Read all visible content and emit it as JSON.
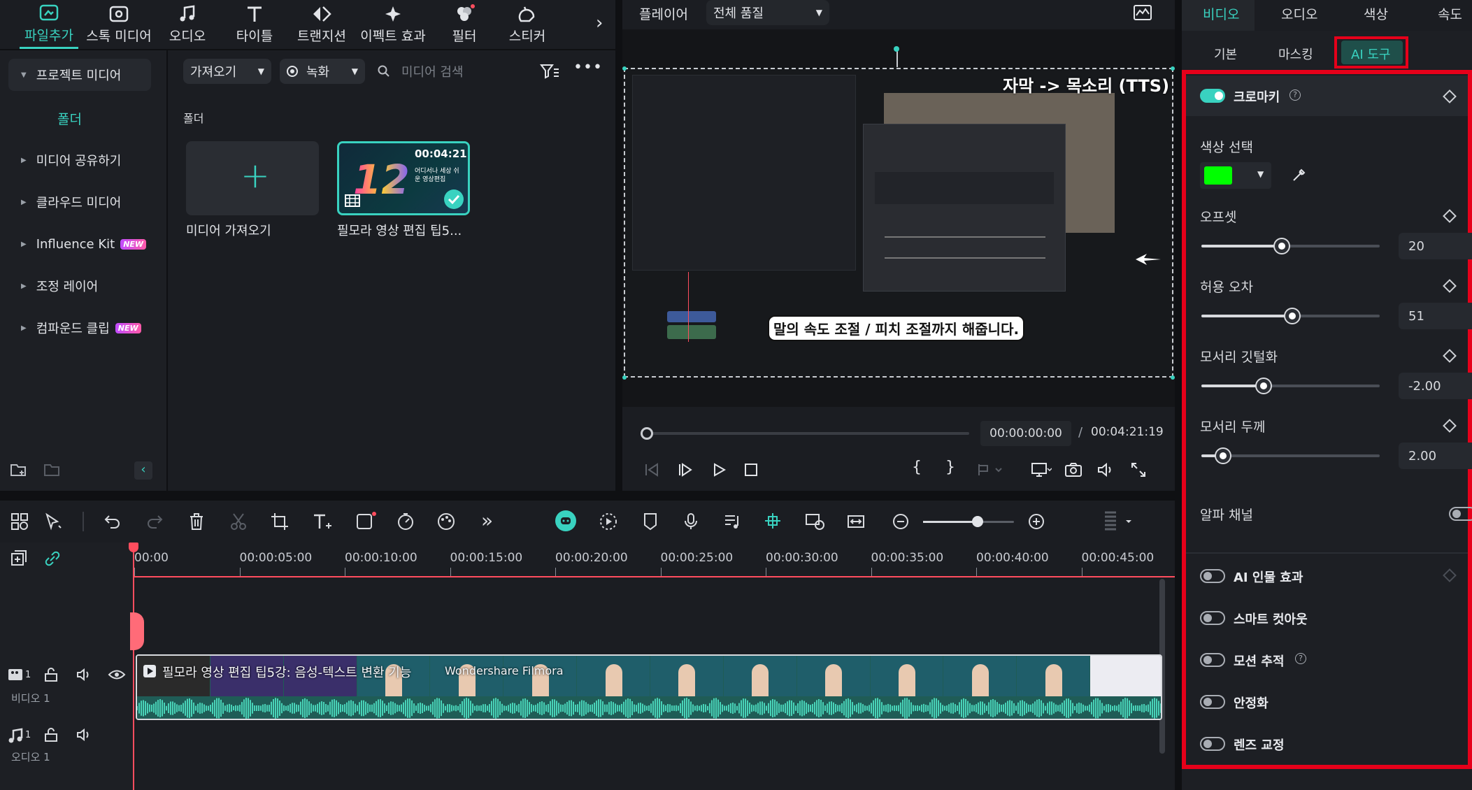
{
  "toolbar": {
    "items": [
      {
        "label": "파일추가",
        "icon": "import-icon",
        "active": true
      },
      {
        "label": "스톡 미디어",
        "icon": "stock-media-icon"
      },
      {
        "label": "오디오",
        "icon": "music-note-icon"
      },
      {
        "label": "타이틀",
        "icon": "title-t-icon"
      },
      {
        "label": "트랜지션",
        "icon": "transition-icon"
      },
      {
        "label": "이펙트 효과",
        "icon": "effects-sparkle-icon"
      },
      {
        "label": "필터",
        "icon": "filter-circles-icon"
      },
      {
        "label": "스티커",
        "icon": "sticker-icon"
      }
    ],
    "accent": "#39d2c0"
  },
  "media_sidebar": {
    "project_media": "프로젝트 미디어",
    "folder": "폴더",
    "items": [
      {
        "label": "미디어 공유하기"
      },
      {
        "label": "클라우드 미디어"
      },
      {
        "label": "Influence Kit",
        "badge": "NEW"
      },
      {
        "label": "조정 레이어"
      },
      {
        "label": "컴파운드 클립",
        "badge": "NEW"
      }
    ]
  },
  "media_main": {
    "import_dropdown": "가져오기",
    "record_dropdown": "녹화",
    "search_placeholder": "미디어 검색",
    "folder_title": "폴더",
    "import_tile_label": "미디어 가져오기",
    "clip_tile": {
      "duration": "00:04:21",
      "label": "필모라 영상 편집 팁5...",
      "thumb_caption": "어디서나 세상 쉬운 영상편집"
    }
  },
  "player": {
    "title": "플레이어",
    "quality": "전체 품질",
    "overlay_top": "자막 -> 목소리 (TTS)",
    "overlay_bottom": "말의 속도 조절 / 피치 조절까지 해줍니다.",
    "current_time": "00:00:00:00",
    "separator": "/",
    "total_time": "00:04:21:19",
    "progress": 0
  },
  "inspector": {
    "tabs": [
      "비디오",
      "오디오",
      "색상",
      "속도"
    ],
    "active_tab": "비디오",
    "subtabs": [
      "기본",
      "마스킹",
      "AI 도구"
    ],
    "active_subtab": "AI 도구",
    "chroma_key": {
      "label": "크로마키",
      "on": true
    },
    "color_select_label": "색상 선택",
    "key_color": "#00ff00",
    "params": [
      {
        "label": "오프셋",
        "value": "20",
        "pct": 0.45
      },
      {
        "label": "허용 오차",
        "value": "51",
        "pct": 0.51
      },
      {
        "label": "모서리 깃털화",
        "value": "-2.00",
        "pct": 0.35
      },
      {
        "label": "모서리 두께",
        "value": "2.00",
        "pct": 0.12
      }
    ],
    "alpha_channel": {
      "label": "알파 채널",
      "on": false
    },
    "ai_tools": [
      {
        "label": "AI 인물 효과",
        "on": false
      },
      {
        "label": "스마트 컷아웃",
        "on": false
      },
      {
        "label": "모션 추적",
        "on": false
      },
      {
        "label": "안정화",
        "on": false
      },
      {
        "label": "렌즈 교정",
        "on": false
      }
    ],
    "highlight_color": "#e6001a"
  },
  "timeline": {
    "ruler": [
      "00:00",
      "00:00:05:00",
      "00:00:10:00",
      "00:00:15:00",
      "00:00:20:00",
      "00:00:25:00",
      "00:00:30:00",
      "00:00:35:00",
      "00:00:40:00",
      "00:00:45:00"
    ],
    "tracks": [
      {
        "name": "비디오 1",
        "index": "1"
      },
      {
        "name": "오디오 1",
        "index": "1"
      }
    ],
    "clip_title": "필모라 영상 편집 팁5강: 음성-텍스트 변환 기능",
    "clip_watermark": "Wondershare Filmora",
    "playhead_color": "#ff4d5e",
    "zoom_level": 0.6
  }
}
